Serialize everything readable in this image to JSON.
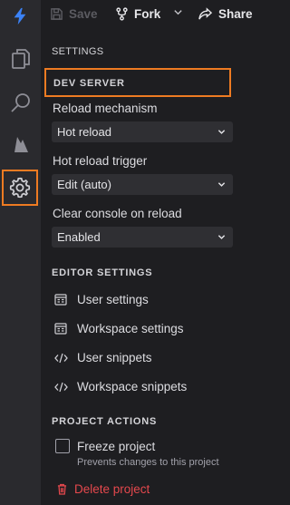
{
  "toolbar": {
    "save_label": "Save",
    "fork_label": "Fork",
    "share_label": "Share"
  },
  "activity_bar": {
    "items": [
      "files-icon",
      "search-icon",
      "deploy-icon",
      "settings-icon"
    ],
    "active": "settings-icon"
  },
  "settings": {
    "title": "SETTINGS",
    "dev_server": {
      "header": "DEV SERVER",
      "reload_mechanism": {
        "label": "Reload mechanism",
        "value": "Hot reload"
      },
      "hot_reload_trigger": {
        "label": "Hot reload trigger",
        "value": "Edit (auto)"
      },
      "clear_console": {
        "label": "Clear console on reload",
        "value": "Enabled"
      }
    },
    "editor_settings": {
      "header": "EDITOR SETTINGS",
      "items": [
        "User settings",
        "Workspace settings",
        "User snippets",
        "Workspace snippets"
      ]
    },
    "project_actions": {
      "header": "PROJECT ACTIONS",
      "freeze_label": "Freeze project",
      "freeze_desc": "Prevents changes to this project",
      "freeze_checked": false,
      "delete_label": "Delete project"
    }
  },
  "colors": {
    "accent": "#ee7b22",
    "brand": "#3b82f6",
    "danger": "#e5484d"
  }
}
